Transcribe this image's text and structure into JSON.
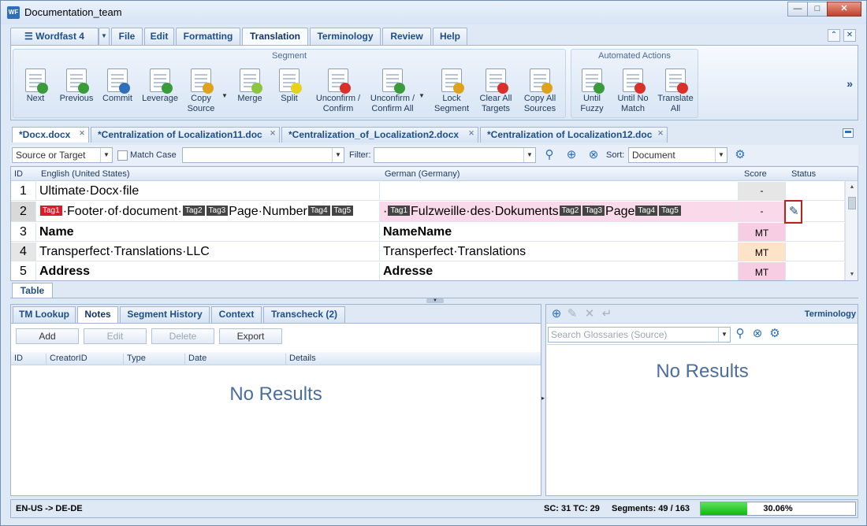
{
  "window": {
    "title": "Documentation_team",
    "icon_text": "WF"
  },
  "menu": {
    "app_label": "Wordfast 4",
    "tabs": [
      "File",
      "Edit",
      "Formatting",
      "Translation",
      "Terminology",
      "Review",
      "Help"
    ],
    "active_tab": "Translation"
  },
  "ribbon": {
    "segment_group": "Segment",
    "segment_buttons": [
      {
        "label": "Next",
        "icon": "next-icon",
        "color": "#3a9b3a"
      },
      {
        "label": "Previous",
        "icon": "previous-icon",
        "color": "#3a9b3a"
      },
      {
        "label": "Commit",
        "icon": "commit-icon",
        "color": "#2d6fb8"
      },
      {
        "label": "Leverage",
        "icon": "leverage-icon",
        "color": "#3a9b3a"
      },
      {
        "label": "Copy Source",
        "icon": "copy-source-icon",
        "color": "#e0a21b"
      },
      {
        "label": "Merge",
        "icon": "merge-icon",
        "color": "#8cc63f"
      },
      {
        "label": "Split",
        "icon": "split-icon",
        "color": "#e6d21b"
      },
      {
        "label": "Unconfirm / Confirm",
        "icon": "unconfirm-confirm-icon",
        "color": "#d9302a"
      },
      {
        "label": "Unconfirm / Confirm All",
        "icon": "unconfirm-confirm-all-icon",
        "color": "#3a9b3a"
      },
      {
        "label": "Lock Segment",
        "icon": "lock-icon",
        "color": "#e0a21b"
      },
      {
        "label": "Clear All Targets",
        "icon": "clear-targets-icon",
        "color": "#d9302a"
      },
      {
        "label": "Copy All Sources",
        "icon": "copy-all-sources-icon",
        "color": "#e0a21b"
      }
    ],
    "auto_group": "Automated Actions",
    "auto_buttons": [
      {
        "label": "Until Fuzzy",
        "icon": "until-fuzzy-icon",
        "color": "#3a9b3a"
      },
      {
        "label": "Until No Match",
        "icon": "until-no-match-icon",
        "color": "#d9302a"
      },
      {
        "label": "Translate All",
        "icon": "translate-all-icon",
        "color": "#d9302a"
      }
    ],
    "more": "»"
  },
  "doc_tabs": [
    {
      "label": "*Docx.docx",
      "active": true
    },
    {
      "label": "*Centralization of Localization11.doc",
      "active": false
    },
    {
      "label": "*Centralization_of_Localization2.docx",
      "active": false
    },
    {
      "label": "*Centralization of Localization12.doc",
      "active": false
    }
  ],
  "filter": {
    "scope": "Source or Target",
    "match_case": "Match Case",
    "search_value": "",
    "filter_label": "Filter:",
    "filter_value": "",
    "sort_label": "Sort:",
    "sort_value": "Document"
  },
  "grid": {
    "headers": {
      "id": "ID",
      "source": "English (United States)",
      "target": "German (Germany)",
      "score": "Score",
      "status": "Status"
    },
    "rows": [
      {
        "id": "1",
        "source": "Ultimate·Docx·file",
        "target": "",
        "score": "-",
        "score_bg": "#e6e6e6"
      },
      {
        "id": "2",
        "source_parts": [
          "Tag1",
          "·Footer·of·document·",
          "Tag2",
          "Tag3",
          "Page·Number",
          "Tag4",
          "Tag5"
        ],
        "target_parts": [
          "·",
          "Tag1",
          "Fulzweille·des·Dokuments",
          "Tag2",
          "Tag3",
          "Page",
          "Tag4",
          "Tag5"
        ],
        "score": "-",
        "score_bg": "#f7cde3",
        "status_icon": "edit-pencil-icon"
      },
      {
        "id": "3",
        "source": "Name",
        "target": "NameName",
        "score": "MT",
        "score_bg": "#f7cde3",
        "bold": true
      },
      {
        "id": "4",
        "source": "Transperfect·Translations·LLC",
        "target": "Transperfect·Translations",
        "score": "MT",
        "score_bg": "#fde3c8"
      },
      {
        "id": "5",
        "source": "Address",
        "target": "Adresse",
        "score": "MT",
        "score_bg": "#f7cde3",
        "bold": true
      }
    ]
  },
  "table_tab": "Table",
  "lower_left": {
    "tabs": [
      "TM Lookup",
      "Notes",
      "Segment History",
      "Context",
      "Transcheck (2)"
    ],
    "active_tab": "Notes",
    "buttons": [
      "Add",
      "Edit",
      "Delete",
      "Export"
    ],
    "columns": [
      "ID",
      "CreatorID",
      "Type",
      "Date",
      "Details"
    ],
    "empty_text": "No Results"
  },
  "lower_right": {
    "title": "Terminology",
    "search_placeholder": "Search Glossaries (Source)",
    "empty_text": "No Results"
  },
  "status": {
    "lang_pair": "EN-US -> DE-DE",
    "sc_tc": "SC: 31 TC: 29",
    "segments": "Segments: 49 / 163",
    "progress_text": "30.06%",
    "progress_value": 30.06
  }
}
